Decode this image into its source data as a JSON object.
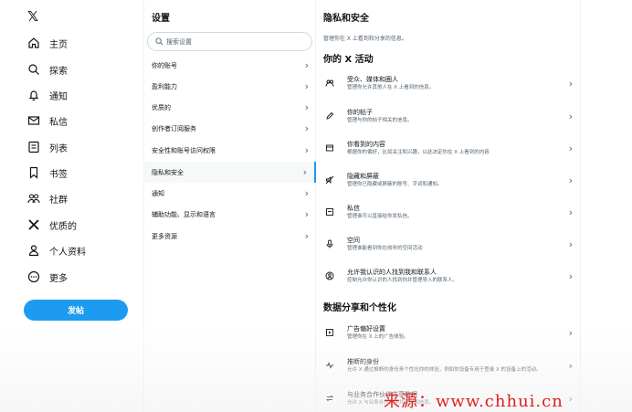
{
  "nav": {
    "logo": "𝕏",
    "items": [
      {
        "label": "主页",
        "icon": "home-icon"
      },
      {
        "label": "探索",
        "icon": "search-icon"
      },
      {
        "label": "通知",
        "icon": "bell-icon"
      },
      {
        "label": "私信",
        "icon": "mail-icon"
      },
      {
        "label": "列表",
        "icon": "list-icon"
      },
      {
        "label": "书签",
        "icon": "bookmark-icon"
      },
      {
        "label": "社群",
        "icon": "communities-icon"
      },
      {
        "label": "优质的",
        "icon": "x-logo-icon"
      },
      {
        "label": "个人资料",
        "icon": "person-icon"
      },
      {
        "label": "更多",
        "icon": "more-icon"
      }
    ],
    "post_label": "发帖"
  },
  "settings": {
    "title": "设置",
    "search_placeholder": "搜索设置",
    "items": [
      {
        "label": "你的账号"
      },
      {
        "label": "盈利能力"
      },
      {
        "label": "优质的"
      },
      {
        "label": "创作者订阅服务"
      },
      {
        "label": "安全性和账号访问权限"
      },
      {
        "label": "隐私和安全"
      },
      {
        "label": "通知"
      },
      {
        "label": "辅助功能、显示和语言"
      },
      {
        "label": "更多资源"
      }
    ],
    "active_item": "隐私和安全"
  },
  "privacy": {
    "title": "隐私和安全",
    "description": "管理你在 X 上看到和分享的信息。",
    "section1_title": "你的 X 活动",
    "section1_rows": [
      {
        "title": "受众、媒体和圈人",
        "subtitle": "管理你允许其他人在 X 上看到的信息。",
        "icon": "people-icon"
      },
      {
        "title": "你的帖子",
        "subtitle": "管理与你的帖子相关的信息。",
        "icon": "pencil-icon"
      },
      {
        "title": "你看到的内容",
        "subtitle": "根据你的偏好，比如关注和兴趣，以此决定你在 X 上看到的内容",
        "icon": "content-icon"
      },
      {
        "title": "隐藏和屏蔽",
        "subtitle": "管理你已隐藏或屏蔽的账号、字词和通知。",
        "icon": "mute-icon"
      },
      {
        "title": "私信",
        "subtitle": "管理谁可以直接给你发私信。",
        "icon": "message-icon"
      },
      {
        "title": "空间",
        "subtitle": "管理谁能看到你在收听的空间活动",
        "icon": "spaces-icon"
      },
      {
        "title": "允许我认识的人找到我和联系人",
        "subtitle": "控制允许你认识的人找到你并管理导入的联系人。",
        "icon": "contacts-icon"
      }
    ],
    "section2_title": "数据分享和个性化",
    "section2_rows": [
      {
        "title": "广告偏好设置",
        "subtitle": "管理你在 X 上的广告体验。",
        "icon": "ads-icon"
      },
      {
        "title": "推断的身份",
        "subtitle": "允许 X 通过推断的身份来个性化你的体验，例如你设备专用于登录 X 的设备上的活动。",
        "icon": "activity-icon"
      },
      {
        "title": "与业务合作伙伴共享数据",
        "subtitle": "允许 X 与业务合作伙伴共享附加信息。",
        "icon": "share-icon"
      }
    ]
  },
  "watermark": "来源：www.chhui.cn",
  "colors": {
    "accent": "#1d9bf0",
    "watermark": "#e0201e"
  }
}
